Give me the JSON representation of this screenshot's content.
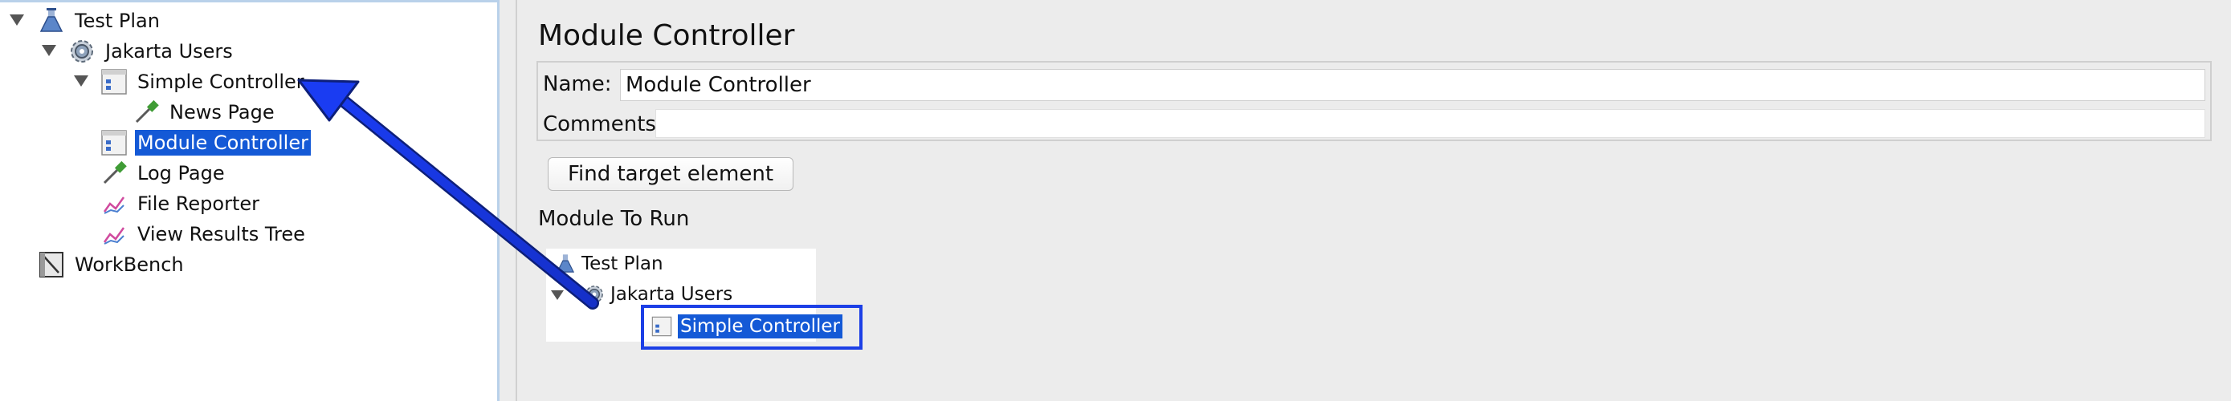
{
  "tree": {
    "test_plan": "Test Plan",
    "jakarta_users": "Jakarta Users",
    "simple_controller": "Simple Controller",
    "news_page": "News Page",
    "module_controller": "Module Controller",
    "log_page": "Log Page",
    "file_reporter": "File Reporter",
    "view_results_tree": "View Results Tree",
    "workbench": "WorkBench"
  },
  "panel": {
    "title": "Module Controller",
    "name_label": "Name:",
    "name_value": "Module Controller",
    "comments_label": "Comments:",
    "comments_value": "",
    "find_button": "Find target element",
    "module_to_run_label": "Module To Run"
  },
  "module_tree": {
    "test_plan": "Test Plan",
    "jakarta_users": "Jakarta Users",
    "simple_controller": "Simple Controller"
  },
  "colors": {
    "selection": "#1459d6",
    "annotation_arrow": "#1c3fe6"
  }
}
